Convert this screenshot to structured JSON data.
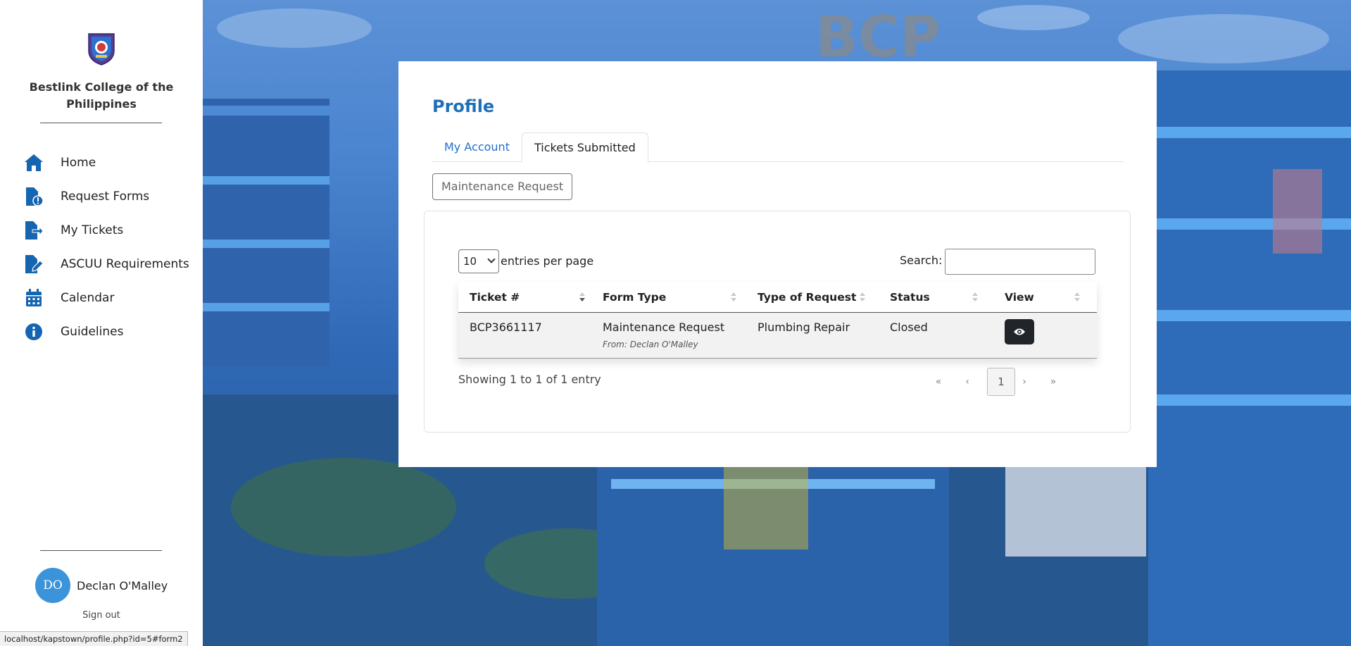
{
  "sidebar": {
    "brand": "Bestlink College of the Philippines",
    "items": [
      {
        "label": "Home",
        "icon": "home-icon"
      },
      {
        "label": "Request Forms",
        "icon": "file-exclamation-icon"
      },
      {
        "label": "My Tickets",
        "icon": "file-export-icon"
      },
      {
        "label": "ASCUU Requirements",
        "icon": "file-pen-icon"
      },
      {
        "label": "Calendar",
        "icon": "calendar-icon"
      },
      {
        "label": "Guidelines",
        "icon": "info-circle-icon"
      }
    ],
    "user": {
      "initials": "DO",
      "name": "Declan O'Malley"
    },
    "signout": "Sign out"
  },
  "status_url": "localhost/kapstown/profile.php?id=5#form2",
  "profile": {
    "title": "Profile",
    "tabs": [
      {
        "label": "My Account",
        "active": false
      },
      {
        "label": "Tickets Submitted",
        "active": true
      }
    ],
    "filter_button": "Maintenance Request"
  },
  "table": {
    "length_value": "10",
    "length_label": "entries per page",
    "search_label": "Search:",
    "search_value": "",
    "columns": [
      "Ticket #",
      "Form Type",
      "Type of Request",
      "Status",
      "View"
    ],
    "rows": [
      {
        "ticket": "BCP3661117",
        "form_type": "Maintenance Request",
        "from": "From: Declan O'Malley",
        "type_of_request": "Plumbing Repair",
        "status": "Closed"
      }
    ],
    "info": "Showing 1 to 1 of 1 entry",
    "pagination": {
      "first": "«",
      "prev": "‹",
      "current": "1",
      "next": "›",
      "last": "»"
    }
  },
  "colors": {
    "accent": "#1e6fb8",
    "sidebar_icon": "#1565b0",
    "avatar": "#3b93d9",
    "view_button": "#212529"
  }
}
